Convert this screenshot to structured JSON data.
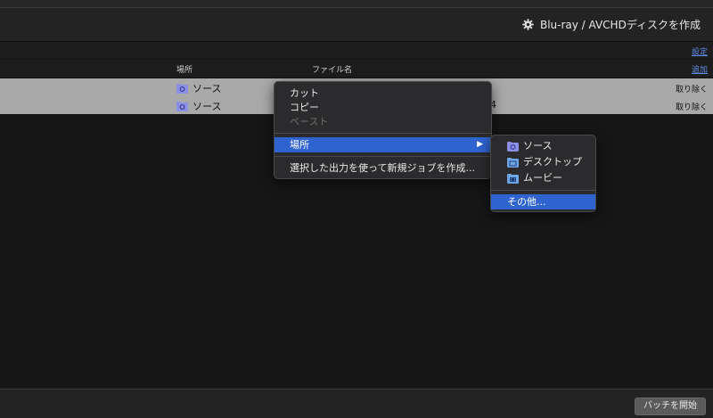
{
  "header": {
    "action_label": "Blu-ray / AVCHDディスクを作成",
    "action_icon": "gear-icon"
  },
  "settings": {
    "link_label": "設定"
  },
  "table": {
    "columns": [
      "場所",
      "ファイル名"
    ],
    "add_label": "追加",
    "rows": [
      {
        "location": "ソース",
        "filename_suffix": "",
        "remove_label": "取り除く"
      },
      {
        "location": "ソース",
        "filename_suffix": "4",
        "remove_label": "取り除く"
      }
    ]
  },
  "context_menu": {
    "items": [
      {
        "label": "カット",
        "enabled": true
      },
      {
        "label": "コピー",
        "enabled": true
      },
      {
        "label": "ペースト",
        "enabled": false
      },
      {
        "label": "場所",
        "enabled": true,
        "highlighted": true,
        "submenu_arrow": "▶"
      },
      {
        "label": "選択した出力を使って新規ジョブを作成...",
        "enabled": true
      }
    ]
  },
  "location_submenu": {
    "items": [
      {
        "label": "ソース",
        "icon": "folder-icon"
      },
      {
        "label": "デスクトップ",
        "icon": "folder-icon"
      },
      {
        "label": "ムービー",
        "icon": "movies-folder-icon"
      },
      {
        "label": "その他...",
        "highlighted": true
      }
    ]
  },
  "footer": {
    "start_button_label": "バッチを開始"
  },
  "colors": {
    "accent": "#2f63d0",
    "link": "#5f8ce6",
    "folder": "#8b8fe6"
  }
}
